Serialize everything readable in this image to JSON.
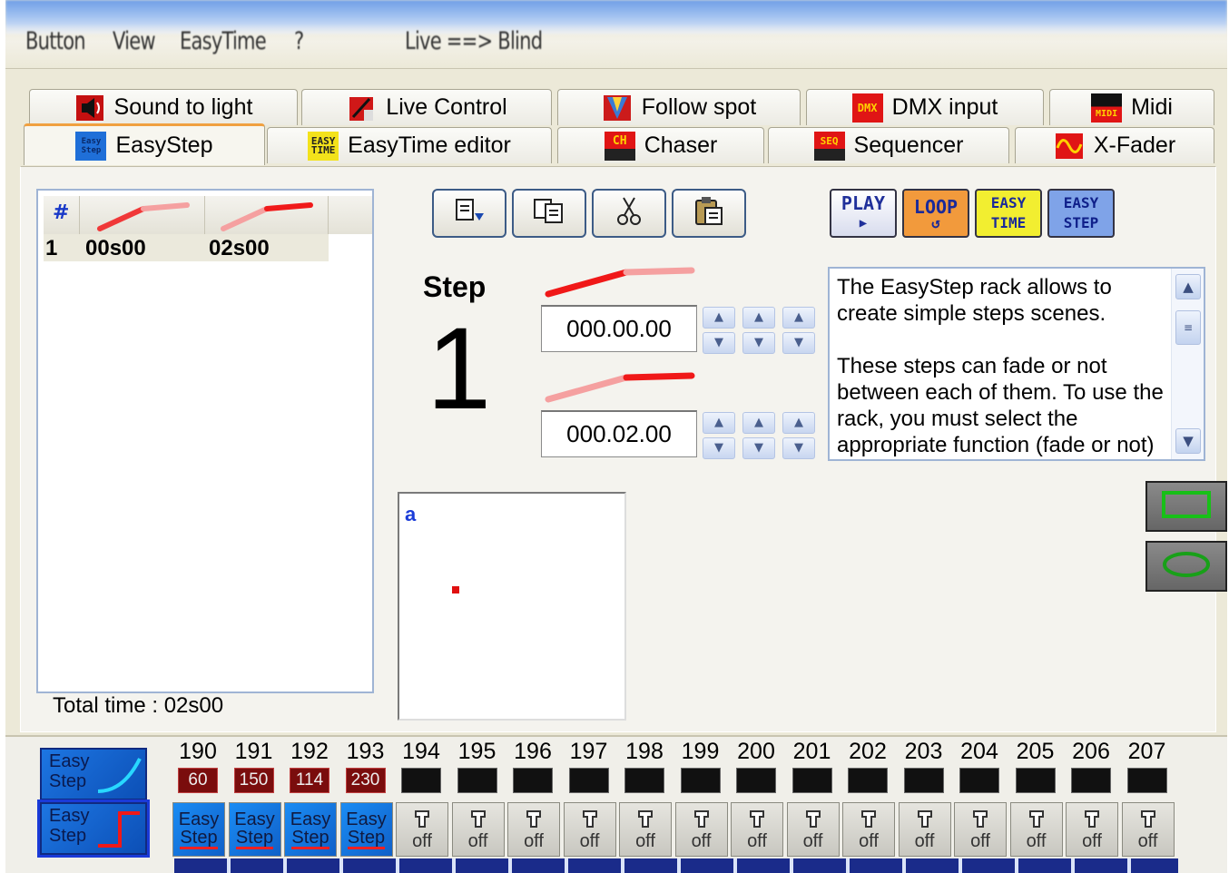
{
  "menu": {
    "items": [
      "Button",
      "View",
      "EasyTime",
      "?"
    ],
    "mode": "Live ==> Blind"
  },
  "tabs": {
    "row1": [
      {
        "label": "Sound to light",
        "icon": "speaker-icon"
      },
      {
        "label": "Live Control",
        "icon": "live-control-icon"
      },
      {
        "label": "Follow spot",
        "icon": "follow-spot-icon"
      },
      {
        "label": "DMX input",
        "icon": "dmx-input-icon",
        "badge": "DMX"
      },
      {
        "label": "Midi",
        "icon": "midi-icon",
        "badge": "MIDI"
      }
    ],
    "row2": [
      {
        "label": "EasyStep",
        "icon": "easystep-icon",
        "selected": true,
        "badge": "Easy Step"
      },
      {
        "label": "EasyTime editor",
        "icon": "easytime-icon",
        "badge": "EASY TIME"
      },
      {
        "label": "Chaser",
        "icon": "chaser-icon",
        "badge": "CH"
      },
      {
        "label": "Sequencer",
        "icon": "sequencer-icon",
        "badge": "SEQ"
      },
      {
        "label": "X-Fader",
        "icon": "xfader-icon"
      }
    ]
  },
  "steps": {
    "col_hash": "#",
    "rows": [
      {
        "num": "1",
        "fade": "00s00",
        "wait": "02s00"
      }
    ],
    "total": "Total time : 02s00"
  },
  "toolbar": {
    "copy": "copy-icon",
    "duplicate": "duplicate-icon",
    "cut": "cut-icon",
    "paste": "paste-icon"
  },
  "modes": {
    "play": "PLAY",
    "loop": "LOOP",
    "easytime": [
      "EASY",
      "TIME"
    ],
    "easystep": [
      "EASY",
      "STEP"
    ]
  },
  "step": {
    "label": "Step",
    "number": "1",
    "fade_time": "000.00.00",
    "wait_time": "000.02.00"
  },
  "description": "The EasyStep rack allows to create simple steps scenes.\n\nThese steps can fade or not between each of them. To use the rack, you must select the appropriate function (fade or not)",
  "preview": {
    "label": "a"
  },
  "racks": [
    [
      "Easy",
      "Step"
    ],
    [
      "Easy",
      "Step"
    ]
  ],
  "channels": [
    {
      "n": "190",
      "v": "60"
    },
    {
      "n": "191",
      "v": "150"
    },
    {
      "n": "192",
      "v": "114"
    },
    {
      "n": "193",
      "v": "230"
    },
    {
      "n": "194",
      "v": ""
    },
    {
      "n": "195",
      "v": ""
    },
    {
      "n": "196",
      "v": ""
    },
    {
      "n": "197",
      "v": ""
    },
    {
      "n": "198",
      "v": ""
    },
    {
      "n": "199",
      "v": ""
    },
    {
      "n": "200",
      "v": ""
    },
    {
      "n": "201",
      "v": ""
    },
    {
      "n": "202",
      "v": ""
    },
    {
      "n": "203",
      "v": ""
    },
    {
      "n": "204",
      "v": ""
    },
    {
      "n": "205",
      "v": ""
    },
    {
      "n": "206",
      "v": ""
    },
    {
      "n": "207",
      "v": ""
    }
  ],
  "channel_fx": {
    "easy_top": "Easy",
    "easy_bottom": "Step",
    "off": "off"
  }
}
